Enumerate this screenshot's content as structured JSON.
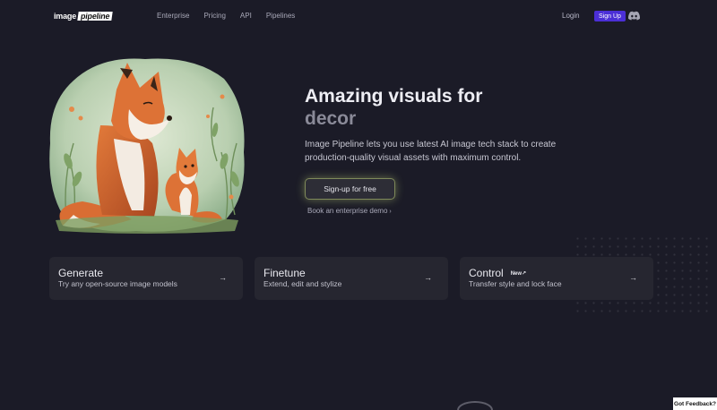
{
  "nav": {
    "logo_part1": "image",
    "logo_part2": "pipeline",
    "links": [
      "Enterprise",
      "Pricing",
      "API",
      "Pipelines"
    ],
    "login": "Login",
    "signup": "Sign Up",
    "discord_icon": "discord-icon"
  },
  "hero": {
    "title": "Amazing visuals for",
    "title_highlight": "decor",
    "description": "Image Pipeline lets you use latest AI image tech stack to create production-quality visual assets with maximum control.",
    "cta": "Sign-up for free",
    "demo_link": "Book an enterprise demo",
    "demo_arrow": "›"
  },
  "cards": [
    {
      "title": "Generate",
      "desc": "Try any open-source image models",
      "arrow": "→",
      "badge": ""
    },
    {
      "title": "Finetune",
      "desc": "Extend, edit and stylize",
      "arrow": "→",
      "badge": ""
    },
    {
      "title": "Control",
      "desc": "Transfer style and lock face",
      "arrow": "→",
      "badge": "New↗"
    }
  ],
  "feedback": "Got Feedback?",
  "colors": {
    "background": "#1b1b27",
    "card": "#262630",
    "signup": "#4b2fd6",
    "cta_glow": "#c5d979"
  }
}
